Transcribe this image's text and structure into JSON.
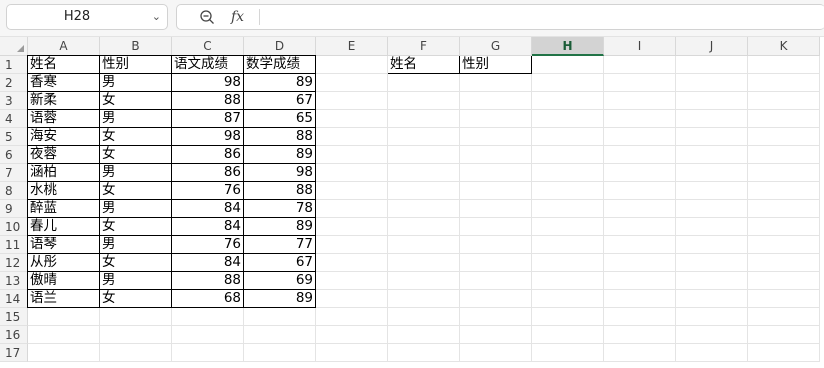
{
  "formula_bar": {
    "cell_ref": "H28",
    "fx_label": "fx",
    "formula": ""
  },
  "columns": [
    "A",
    "B",
    "C",
    "D",
    "E",
    "F",
    "G",
    "H",
    "I",
    "J",
    "K"
  ],
  "selected_column": "H",
  "rows": [
    "1",
    "2",
    "3",
    "4",
    "5",
    "6",
    "7",
    "8",
    "9",
    "10",
    "11",
    "12",
    "13",
    "14",
    "15",
    "16",
    "17"
  ],
  "table": {
    "headers": [
      "姓名",
      "性别",
      "语文成绩",
      "数学成绩"
    ],
    "records": [
      [
        "香寒",
        "男",
        "98",
        "89"
      ],
      [
        "新柔",
        "女",
        "88",
        "67"
      ],
      [
        "语蓉",
        "男",
        "87",
        "65"
      ],
      [
        "海安",
        "女",
        "98",
        "88"
      ],
      [
        "夜蓉",
        "女",
        "86",
        "89"
      ],
      [
        "涵柏",
        "男",
        "86",
        "98"
      ],
      [
        "水桃",
        "女",
        "76",
        "88"
      ],
      [
        "醉蓝",
        "男",
        "84",
        "78"
      ],
      [
        "春儿",
        "女",
        "84",
        "89"
      ],
      [
        "语琴",
        "男",
        "76",
        "77"
      ],
      [
        "从彤",
        "女",
        "84",
        "67"
      ],
      [
        "傲晴",
        "男",
        "88",
        "69"
      ],
      [
        "语兰",
        "女",
        "68",
        "89"
      ]
    ]
  },
  "lookup_headers": [
    "姓名",
    "性别"
  ],
  "colors": {
    "selected_column_accent": "#217346",
    "border": "#000000"
  }
}
